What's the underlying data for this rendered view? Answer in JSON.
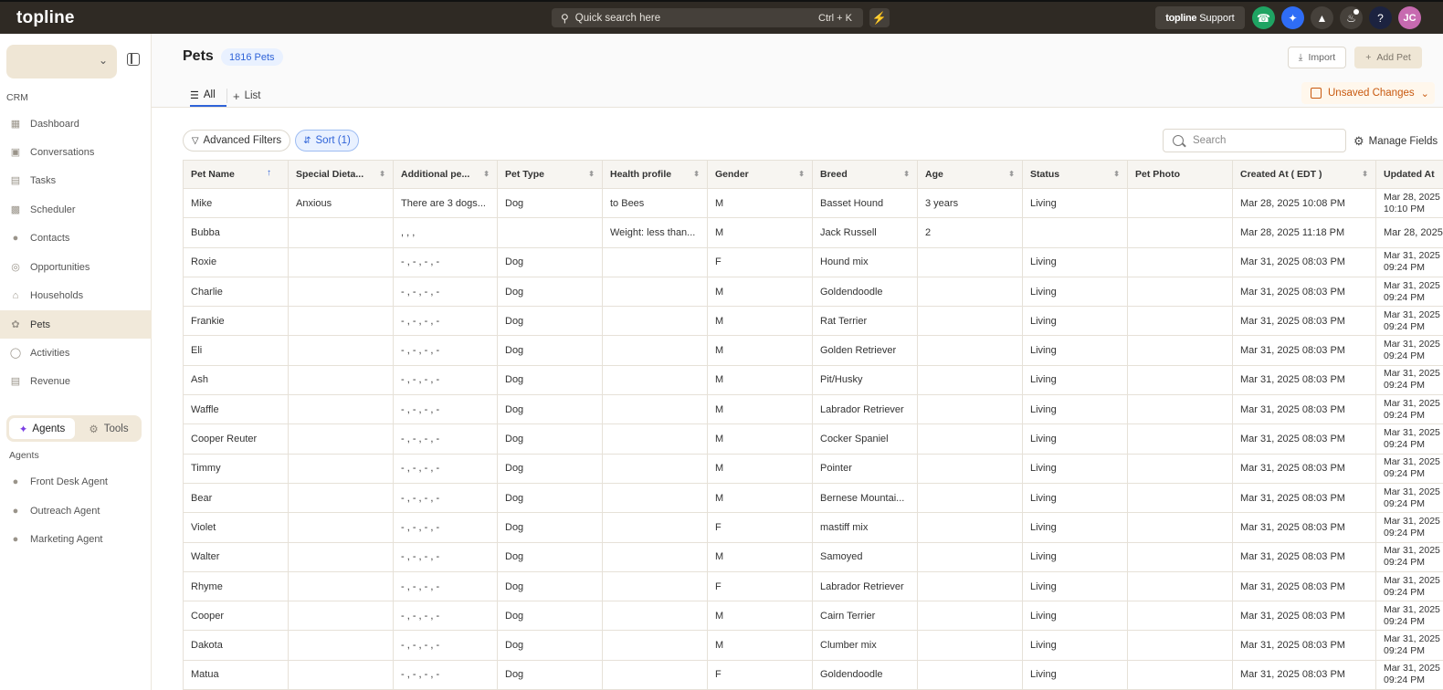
{
  "topbar": {
    "brand": "topline",
    "quick_search_placeholder": "Quick search here",
    "quick_search_shortcut": "Ctrl + K",
    "support_brand": "topline",
    "support_label": "Support",
    "avatar_initials": "JC"
  },
  "sidebar": {
    "section_crm": "CRM",
    "items": [
      {
        "label": "Dashboard",
        "icon": "dashboard-icon"
      },
      {
        "label": "Conversations",
        "icon": "chat-icon"
      },
      {
        "label": "Tasks",
        "icon": "task-icon"
      },
      {
        "label": "Scheduler",
        "icon": "calendar-icon"
      },
      {
        "label": "Contacts",
        "icon": "person-icon"
      },
      {
        "label": "Opportunities",
        "icon": "target-icon"
      },
      {
        "label": "Households",
        "icon": "house-icon"
      },
      {
        "label": "Pets",
        "icon": "paw-icon"
      },
      {
        "label": "Activities",
        "icon": "activity-icon"
      },
      {
        "label": "Revenue",
        "icon": "revenue-icon"
      }
    ],
    "tab_agents": "Agents",
    "tab_tools": "Tools",
    "section_agents": "Agents",
    "agents": [
      {
        "label": "Front Desk Agent"
      },
      {
        "label": "Outreach Agent"
      },
      {
        "label": "Marketing Agent"
      }
    ]
  },
  "main": {
    "title": "Pets",
    "count_badge": "1816 Pets",
    "import_label": "Import",
    "add_label": "Add Pet",
    "view_all": "All",
    "view_list": "List",
    "unsaved_label": "Unsaved Changes",
    "advanced_filters": "Advanced Filters",
    "sort_label": "Sort (1)",
    "search_placeholder": "Search",
    "manage_fields": "Manage Fields"
  },
  "table": {
    "columns": [
      "Pet Name",
      "Special Dieta...",
      "Additional pe...",
      "Pet Type",
      "Health profile",
      "Gender",
      "Breed",
      "Age",
      "Status",
      "Pet Photo",
      "Created At ( EDT )",
      "Updated At"
    ],
    "rows": [
      [
        "Mike",
        "Anxious",
        "There are 3 dogs...",
        "Dog",
        "to Bees",
        "M",
        "Basset Hound",
        "3 years",
        "Living",
        "",
        "Mar 28, 2025 10:08 PM",
        "Mar 28, 2025 10:10 PM"
      ],
      [
        "Bubba",
        "",
        ", , ,",
        "",
        "Weight: less than...",
        "M",
        "Jack Russell",
        "2",
        "",
        "",
        "Mar 28, 2025 11:18 PM",
        "Mar 28, 2025"
      ],
      [
        "Roxie",
        "",
        "- , - , - , -",
        "Dog",
        "",
        "F",
        "Hound mix",
        "",
        "Living",
        "",
        "Mar 31, 2025 08:03 PM",
        "Mar 31, 2025 09:24 PM"
      ],
      [
        "Charlie",
        "",
        "- , - , - , -",
        "Dog",
        "",
        "M",
        "Goldendoodle",
        "",
        "Living",
        "",
        "Mar 31, 2025 08:03 PM",
        "Mar 31, 2025 09:24 PM"
      ],
      [
        "Frankie",
        "",
        "- , - , - , -",
        "Dog",
        "",
        "M",
        "Rat Terrier",
        "",
        "Living",
        "",
        "Mar 31, 2025 08:03 PM",
        "Mar 31, 2025 09:24 PM"
      ],
      [
        "Eli",
        "",
        "- , - , - , -",
        "Dog",
        "",
        "M",
        "Golden Retriever",
        "",
        "Living",
        "",
        "Mar 31, 2025 08:03 PM",
        "Mar 31, 2025 09:24 PM"
      ],
      [
        "Ash",
        "",
        "- , - , - , -",
        "Dog",
        "",
        "M",
        "Pit/Husky",
        "",
        "Living",
        "",
        "Mar 31, 2025 08:03 PM",
        "Mar 31, 2025 09:24 PM"
      ],
      [
        "Waffle",
        "",
        "- , - , - , -",
        "Dog",
        "",
        "M",
        "Labrador Retriever",
        "",
        "Living",
        "",
        "Mar 31, 2025 08:03 PM",
        "Mar 31, 2025 09:24 PM"
      ],
      [
        "Cooper Reuter",
        "",
        "- , - , - , -",
        "Dog",
        "",
        "M",
        "Cocker Spaniel",
        "",
        "Living",
        "",
        "Mar 31, 2025 08:03 PM",
        "Mar 31, 2025 09:24 PM"
      ],
      [
        "Timmy",
        "",
        "- , - , - , -",
        "Dog",
        "",
        "M",
        "Pointer",
        "",
        "Living",
        "",
        "Mar 31, 2025 08:03 PM",
        "Mar 31, 2025 09:24 PM"
      ],
      [
        "Bear",
        "",
        "- , - , - , -",
        "Dog",
        "",
        "M",
        "Bernese Mountai...",
        "",
        "Living",
        "",
        "Mar 31, 2025 08:03 PM",
        "Mar 31, 2025 09:24 PM"
      ],
      [
        "Violet",
        "",
        "- , - , - , -",
        "Dog",
        "",
        "F",
        "mastiff mix",
        "",
        "Living",
        "",
        "Mar 31, 2025 08:03 PM",
        "Mar 31, 2025 09:24 PM"
      ],
      [
        "Walter",
        "",
        "- , - , - , -",
        "Dog",
        "",
        "M",
        "Samoyed",
        "",
        "Living",
        "",
        "Mar 31, 2025 08:03 PM",
        "Mar 31, 2025 09:24 PM"
      ],
      [
        "Rhyme",
        "",
        "- , - , - , -",
        "Dog",
        "",
        "F",
        "Labrador Retriever",
        "",
        "Living",
        "",
        "Mar 31, 2025 08:03 PM",
        "Mar 31, 2025 09:24 PM"
      ],
      [
        "Cooper",
        "",
        "- , - , - , -",
        "Dog",
        "",
        "M",
        "Cairn Terrier",
        "",
        "Living",
        "",
        "Mar 31, 2025 08:03 PM",
        "Mar 31, 2025 09:24 PM"
      ],
      [
        "Dakota",
        "",
        "- , - , - , -",
        "Dog",
        "",
        "M",
        "Clumber mix",
        "",
        "Living",
        "",
        "Mar 31, 2025 08:03 PM",
        "Mar 31, 2025 09:24 PM"
      ],
      [
        "Matua",
        "",
        "- , - , - , -",
        "Dog",
        "",
        "F",
        "Goldendoodle",
        "",
        "Living",
        "",
        "Mar 31, 2025 08:03 PM",
        "Mar 31, 2025 09:24 PM"
      ]
    ]
  }
}
